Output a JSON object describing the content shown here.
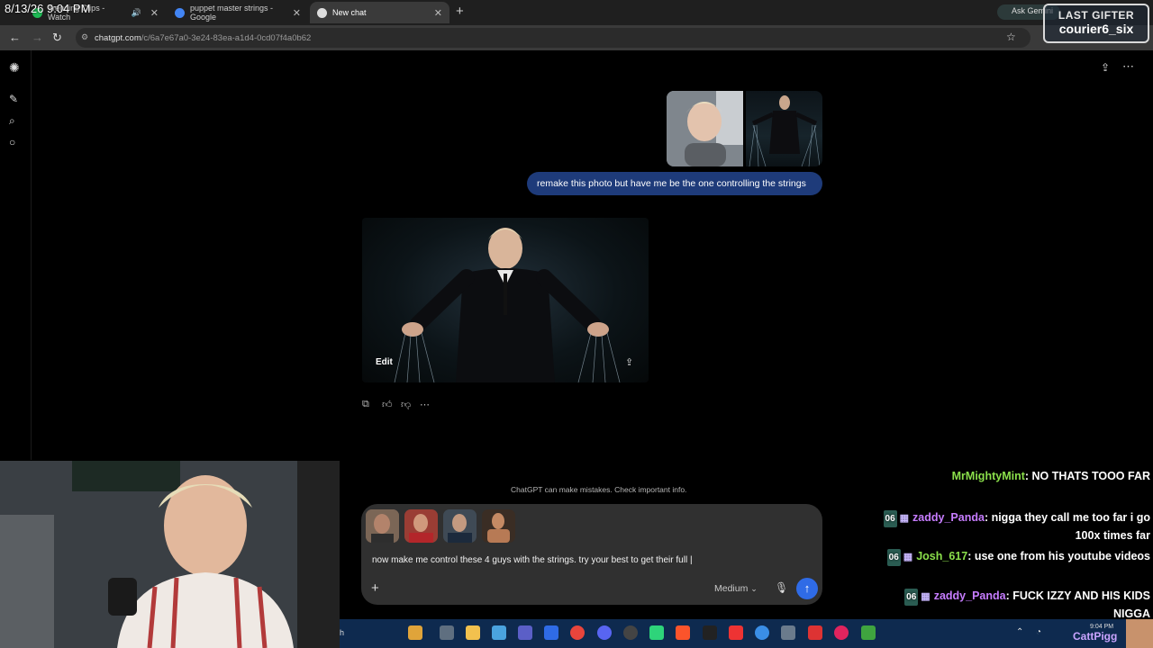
{
  "overlay_time": "8/13/26 9:04 PM",
  "tabs": [
    {
      "title": "Trending Clips - Watch",
      "active": false,
      "color": "#1db954"
    },
    {
      "title": "puppet master strings - Google",
      "active": false,
      "color": "#4285f4"
    },
    {
      "title": "New chat",
      "active": true,
      "color": "#ffffff"
    }
  ],
  "browser": {
    "gemini_label": "Ask Gemini",
    "url_host": "chatgpt.com",
    "url_path": "/c/6a7e67a0-3e24-83ea-a1d4-0cd07f4a0b62"
  },
  "stream_overlay": {
    "gifter_label": "LAST GIFTER",
    "gifter_name": "courier6_six"
  },
  "chat": {
    "user_message": "remake this photo but have me be the one controlling the strings",
    "image_edit_label": "Edit",
    "disclaimer": "ChatGPT can make mistakes. Check important info.",
    "composer_text": "now make me control these 4 guys with the strings. try your best to get their full",
    "model_label": "Medium",
    "attachments": 4
  },
  "twitch_chat": [
    {
      "user": "MrMightyMint",
      "text": ": NO THATS TOOO FAR",
      "color": "#8be04b",
      "badges": false
    },
    {
      "user": "zaddy_Panda",
      "text": ": nigga they call me too far i go 100x times far",
      "color": "#c77dff",
      "badges": true
    },
    {
      "user": "Josh_617",
      "text": ": use one from his youtube videos",
      "color": "#8be04b",
      "badges": true
    },
    {
      "user": "zaddy_Panda",
      "text": ": FUCK IZZY AND HIS KIDS NIGGA",
      "color": "#c77dff",
      "badges": true
    }
  ],
  "taskbar": {
    "search_fragment": "h",
    "clock": "9:04 PM",
    "user_overlay": "CattPigg"
  },
  "accent_colors": {
    "send_button": "#2f6be6",
    "user_bubble": "#1e3b7a",
    "taskbar": "#0e2a4f"
  }
}
